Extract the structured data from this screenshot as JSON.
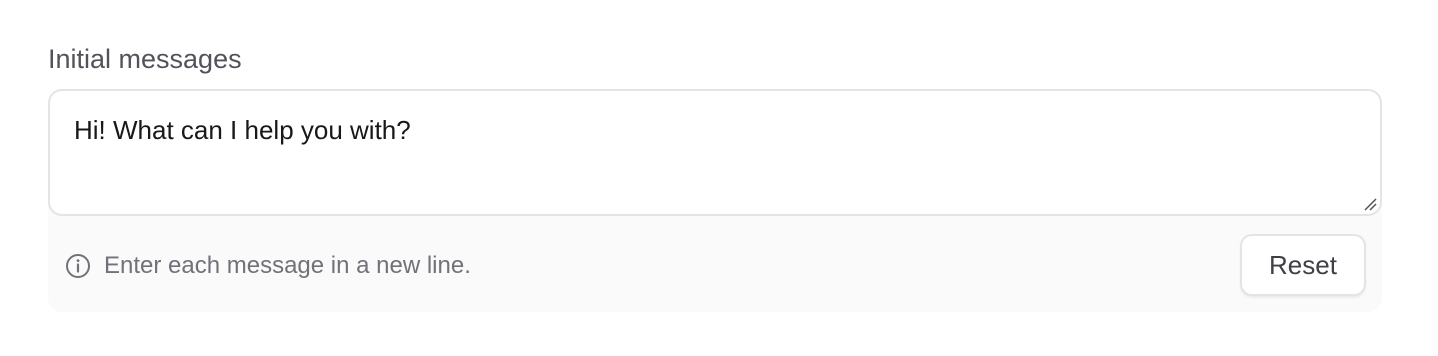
{
  "field": {
    "label": "Initial messages",
    "value": "Hi! What can I help you with?",
    "hint": "Enter each message in a new line.",
    "reset_label": "Reset"
  },
  "icons": {
    "hint_icon": "info-circle-icon",
    "resize_icon": "resize-handle-icon"
  },
  "colors": {
    "label_text": "#52525b",
    "input_text": "#18181b",
    "hint_text": "#71717a",
    "border": "#e4e4e7",
    "footer_background": "#fafafa"
  }
}
